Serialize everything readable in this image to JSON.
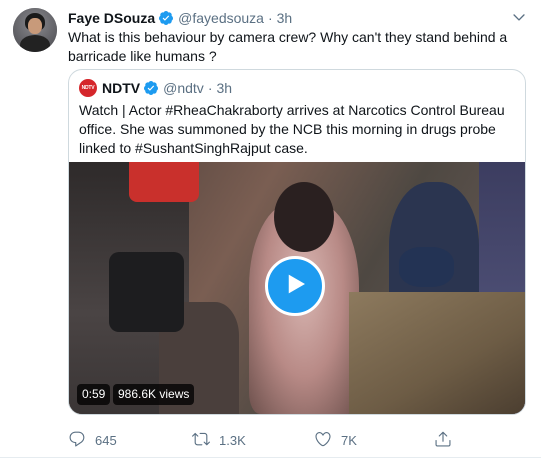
{
  "tweet": {
    "author_name": "Faye DSouza",
    "author_handle": "@fayedsouza",
    "separator": "·",
    "time": "3h",
    "text": "What is this behaviour by camera crew? Why can't they stand behind a barricade like humans ?",
    "verified": true
  },
  "quoted": {
    "avatar_text": "NDTV",
    "author_name": "NDTV",
    "author_handle": "@ndtv",
    "separator": "·",
    "time": "3h",
    "text": "Watch | Actor #RheaChakraborty arrives at Narcotics Control Bureau office. She was summoned by the NCB this morning  in drugs probe linked to #SushantSinghRajput case.",
    "verified": true,
    "media": {
      "type": "video",
      "duration": "0:59",
      "views": "986.6K views"
    }
  },
  "actions": {
    "replies": "645",
    "retweets": "1.3K",
    "likes": "7K"
  },
  "colors": {
    "accent": "#1d9bf0",
    "secondary_text": "#5b7083",
    "border": "#cfd9de",
    "ndtv_red": "#d5262b"
  },
  "icons": [
    "caret-down-icon",
    "verified-badge-icon",
    "play-icon",
    "reply-icon",
    "retweet-icon",
    "like-icon",
    "share-icon"
  ]
}
